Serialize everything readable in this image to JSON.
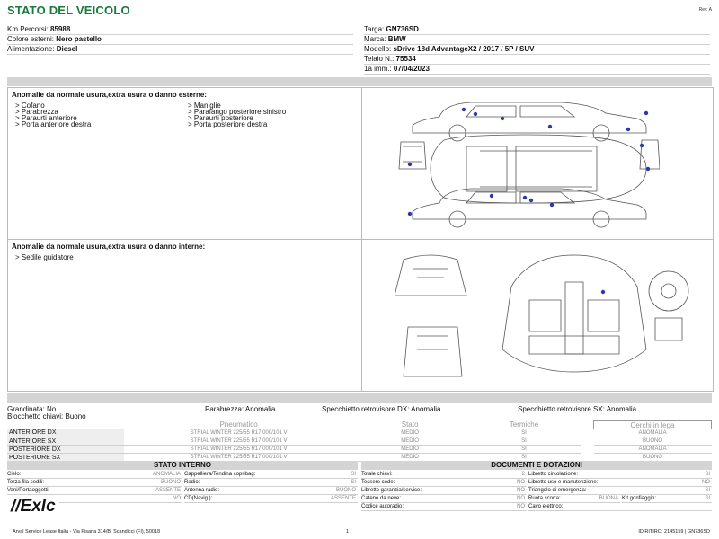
{
  "header": {
    "title": "STATO DEL VEICOLO",
    "rev": "Rev. A"
  },
  "left_fields": [
    {
      "label": "Km Percorsi:",
      "value": "85988"
    },
    {
      "label": "Colore esterni:",
      "value": "Nero pastello"
    },
    {
      "label": "Alimentazione:",
      "value": "Diesel"
    }
  ],
  "right_fields": [
    {
      "label": "Targa:",
      "value": "GN736SD"
    },
    {
      "label": "Marca:",
      "value": "BMW"
    },
    {
      "label": "Modello:",
      "value": "sDrive 18d AdvantageX2 / 2017 / 5P / SUV"
    },
    {
      "label": "Telaio N.:",
      "value": "75534"
    },
    {
      "label": "1a imm.:",
      "value": "07/04/2023"
    }
  ],
  "external": {
    "title": "Anomalie da normale usura,extra usura o danno esterne:",
    "col1": [
      "> Cofano",
      "> Parabrezza",
      "> Paraurti anteriore",
      "> Porta anteriore destra"
    ],
    "col2": [
      "> Maniglie",
      "> Parafango posteriore sinistro",
      "> Paraurti posteriore",
      "> Porta posteriore destra"
    ]
  },
  "internal": {
    "title": "Anomalie da normale usura,extra usura o danno interne:",
    "items": [
      "> Sedile guidatore"
    ]
  },
  "summary": {
    "grandinata": "Grandinata: No",
    "parabrezza": "Parabrezza: Anomalia",
    "specchietto_dx": "Specchietto retrovisore DX: Anomalia",
    "specchietto_sx": "Specchietto retrovisore SX: Anomalia",
    "blocchetto": "Blocchetto chiavi: Buono"
  },
  "tyres": {
    "headers": [
      "Pneumatico",
      "Stato",
      "Termiche",
      "Cerchi in lega"
    ],
    "rows": [
      {
        "pos": "ANTERIORE DX",
        "tyre": "STRIAL WINTER 225/55 R17 000/101 V",
        "stato": "MEDIO",
        "termiche": "SI",
        "cerchi": "ANOMALIA"
      },
      {
        "pos": "ANTERIORE SX",
        "tyre": "STRIAL WINTER 225/55 R17 000/101 V",
        "stato": "MEDIO",
        "termiche": "SI",
        "cerchi": "BUONO"
      },
      {
        "pos": "POSTERIORE DX",
        "tyre": "STRIAL WINTER 225/55 R17 000/101 V",
        "stato": "MEDIO",
        "termiche": "SI",
        "cerchi": "ANOMALIA"
      },
      {
        "pos": "POSTERIORE SX",
        "tyre": "STRIAL WINTER 225/55 R17 000/101 V",
        "stato": "MEDIO",
        "termiche": "SI",
        "cerchi": "BUONO"
      }
    ]
  },
  "stato_interno": {
    "title": "STATO INTERNO",
    "rows": [
      [
        {
          "label": "Cielo:",
          "value": "ANOMALIA"
        },
        {
          "label": "Cappelliera/Tendina copribag:",
          "value": "SI"
        }
      ],
      [
        {
          "label": "Terza fila sedili:",
          "value": "BUONO"
        },
        {
          "label": "Radio:",
          "value": "SI"
        }
      ],
      [
        {
          "label": "Vani/Portaoggetti:",
          "value": "ASSENTE"
        },
        {
          "label": "Antenna radio:",
          "value": "BUONO"
        }
      ],
      [
        {
          "label": "",
          "value": "NO"
        },
        {
          "label": "CD(Navig.):",
          "value": "ASSENTE"
        }
      ]
    ]
  },
  "documenti": {
    "title": "DOCUMENTI E DOTAZIONI",
    "rows": [
      [
        {
          "label": "Totale chiavi:",
          "value": "2"
        },
        {
          "label": "Libretto circolazione:",
          "value": "SI"
        }
      ],
      [
        {
          "label": "Tessere code:",
          "value": "NO"
        },
        {
          "label": "Libretto uso e manutenzione:",
          "value": "NO"
        }
      ],
      [
        {
          "label": "Libretto garanzia/service:",
          "value": "NO"
        },
        {
          "label": "Triangolo di emergenza:",
          "value": "SI"
        }
      ],
      [
        {
          "label": "Catene da neve:",
          "value": "NO"
        },
        {
          "label": "Ruota scorta:",
          "value": "BUONA",
          "label2": "Kit gonfiaggio:",
          "value2": "SI"
        }
      ],
      [
        {
          "label": "Codice autoradio:",
          "value": "NO"
        },
        {
          "label": "Cavo elettrico:",
          "value": ""
        }
      ]
    ]
  },
  "logo": {
    "text": "//Exlc"
  },
  "footer": {
    "address": "Arval Service Lease Italia - Via Pisana 314/B, Scandicci (FI), 50018",
    "page": "1",
    "id": "ID RITIRO: 2145159 | GN736SD"
  },
  "colors": {
    "title_green": "#1a7a3a",
    "dot_blue": "#2a3aa8",
    "band_gray": "#d4d4d4"
  }
}
